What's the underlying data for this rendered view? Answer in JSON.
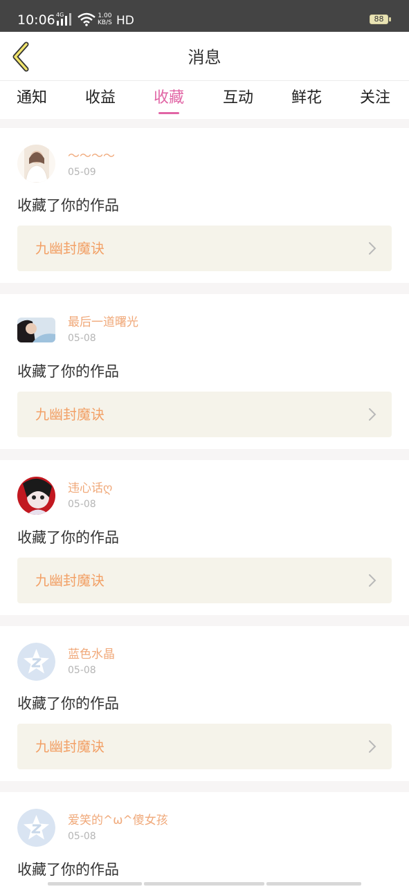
{
  "status_bar": {
    "time": "10:06",
    "network": "4G",
    "speed_value": "1.00",
    "speed_unit": "KB/S",
    "hd": "HD",
    "battery": "88"
  },
  "header": {
    "title": "消息"
  },
  "tabs": [
    {
      "label": "通知",
      "active": false
    },
    {
      "label": "收益",
      "active": false
    },
    {
      "label": "收藏",
      "active": true
    },
    {
      "label": "互动",
      "active": false
    },
    {
      "label": "鲜花",
      "active": false
    },
    {
      "label": "关注",
      "active": false
    }
  ],
  "messages": [
    {
      "user": "～～～～",
      "date": "05-09",
      "action": "收藏了你的作品",
      "work": "九幽封魔诀",
      "avatar": "photo-portrait-1"
    },
    {
      "user": "最后一道曙光",
      "date": "05-08",
      "action": "收藏了你的作品",
      "work": "九幽封魔诀",
      "avatar": "photo-portrait-2"
    },
    {
      "user": "违心话ღ",
      "date": "05-08",
      "action": "收藏了你的作品",
      "work": "九幽封魔诀",
      "avatar": "photo-portrait-3"
    },
    {
      "user": "蓝色水晶",
      "date": "05-08",
      "action": "收藏了你的作品",
      "work": "九幽封魔诀",
      "avatar": "default-star-avatar"
    },
    {
      "user": "爱笑的^ω^傻女孩",
      "date": "05-08",
      "action": "收藏了你的作品",
      "work": "",
      "avatar": "default-star-avatar"
    }
  ],
  "colors": {
    "accent": "#e165a5",
    "username": "#f0a97a",
    "work_title": "#f2a066",
    "work_bg": "#f5f3ea",
    "status_bar": "#444444"
  }
}
